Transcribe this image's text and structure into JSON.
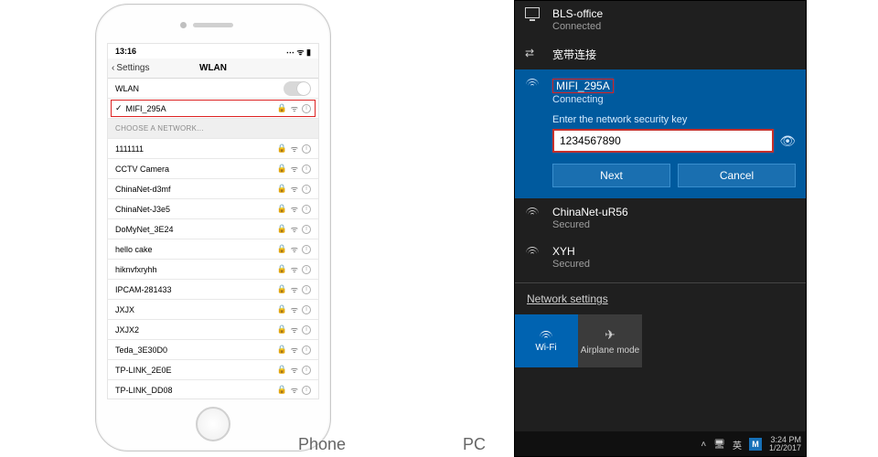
{
  "labels": {
    "phone": "Phone",
    "pc": "PC"
  },
  "phone": {
    "status": {
      "time": "13:16",
      "right": "⋯ ᯤ ▮"
    },
    "nav": {
      "back": "Settings",
      "title": "WLAN"
    },
    "wlan_row": {
      "label": "WLAN"
    },
    "connected": {
      "ssid": "MIFI_295A"
    },
    "section": "CHOOSE A NETWORK...",
    "networks": [
      {
        "ssid": "1111111"
      },
      {
        "ssid": "CCTV Camera"
      },
      {
        "ssid": "ChinaNet-d3mf"
      },
      {
        "ssid": "ChinaNet-J3e5"
      },
      {
        "ssid": "DoMyNet_3E24"
      },
      {
        "ssid": "hello cake"
      },
      {
        "ssid": "hiknvfxryhh"
      },
      {
        "ssid": "IPCAM-281433"
      },
      {
        "ssid": "JXJX"
      },
      {
        "ssid": "JXJX2"
      },
      {
        "ssid": "Teda_3E30D0"
      },
      {
        "ssid": "TP-LINK_2E0E"
      },
      {
        "ssid": "TP-LINK_DD08"
      }
    ]
  },
  "pc": {
    "top_networks": [
      {
        "name": "BLS-office",
        "sub": "Connected",
        "icon": "monitor"
      },
      {
        "name": "宽带连接",
        "sub": "",
        "icon": "dialup"
      }
    ],
    "selected": {
      "name": "MIFI_295A",
      "sub": "Connecting",
      "prompt": "Enter the network security key",
      "input_value": "1234567890",
      "btn_next": "Next",
      "btn_cancel": "Cancel"
    },
    "below_networks": [
      {
        "name": "ChinaNet-uR56",
        "sub": "Secured"
      },
      {
        "name": "XYH",
        "sub": "Secured"
      }
    ],
    "settings_link": "Network settings",
    "tiles": {
      "wifi": "Wi-Fi",
      "airplane": "Airplane mode"
    },
    "taskbar": {
      "ime": "英",
      "m": "M",
      "time": "3:24 PM",
      "date": "1/2/2017"
    }
  }
}
